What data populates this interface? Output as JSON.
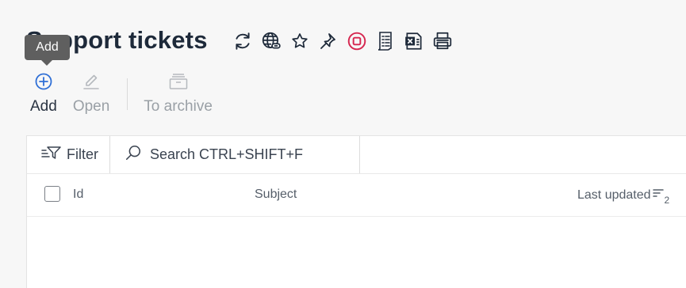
{
  "page": {
    "title": "Support tickets"
  },
  "title_icons": [
    {
      "name": "refresh-icon"
    },
    {
      "name": "web-link-icon"
    },
    {
      "name": "star-icon"
    },
    {
      "name": "pin-icon"
    },
    {
      "name": "stop-record-icon",
      "color": "#d6264f"
    },
    {
      "name": "report-list-icon"
    },
    {
      "name": "excel-export-icon"
    },
    {
      "name": "print-icon"
    }
  ],
  "tooltip": {
    "text": "Add"
  },
  "toolbar": {
    "add_label": "Add",
    "open_label": "Open",
    "archive_label": "To archive"
  },
  "filter": {
    "label": "Filter"
  },
  "search": {
    "placeholder": "Search CTRL+SHIFT+F"
  },
  "table": {
    "columns": {
      "id": "Id",
      "subject": "Subject",
      "last_updated": "Last updated"
    },
    "sort_priority": "2"
  },
  "colors": {
    "accent": "#2f6fd6",
    "danger": "#d6264f",
    "disabled": "#a9aeb4"
  }
}
